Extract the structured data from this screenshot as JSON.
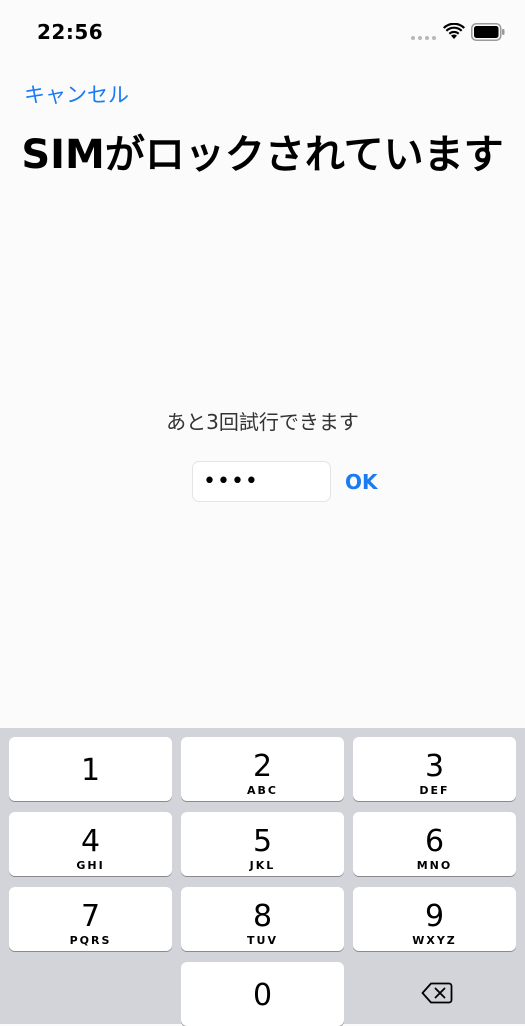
{
  "status_bar": {
    "time": "22:56"
  },
  "nav": {
    "cancel_label": "キャンセル"
  },
  "title": "SIMがロックされています",
  "attempts_text": "あと3回試行できます",
  "pin_field": {
    "value": "••••"
  },
  "ok_label": "OK",
  "keypad": {
    "keys": [
      {
        "digit": "1",
        "letters": ""
      },
      {
        "digit": "2",
        "letters": "ABC"
      },
      {
        "digit": "3",
        "letters": "DEF"
      },
      {
        "digit": "4",
        "letters": "GHI"
      },
      {
        "digit": "5",
        "letters": "JKL"
      },
      {
        "digit": "6",
        "letters": "MNO"
      },
      {
        "digit": "7",
        "letters": "PQRS"
      },
      {
        "digit": "8",
        "letters": "TUV"
      },
      {
        "digit": "9",
        "letters": "WXYZ"
      },
      {
        "digit": "0",
        "letters": ""
      }
    ],
    "delete_icon": "backspace-icon"
  },
  "colors": {
    "accent": "#1a7cf2",
    "keypad_bg": "#d2d4da",
    "page_bg": "#fbfbfb"
  }
}
